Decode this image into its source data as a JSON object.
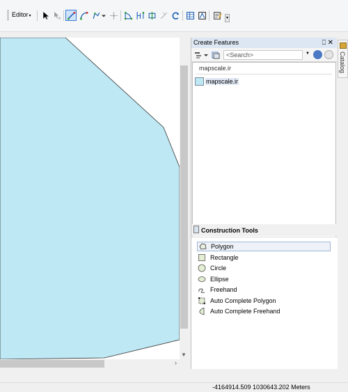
{
  "toolbar": {
    "editor_label": "Editor",
    "editor_caret": "▾",
    "tools": [
      "edit-tool-icon",
      "edit-annotation-icon",
      "straight-segment-icon",
      "endpoint-arc-icon",
      "trace-icon",
      "point-icon",
      "split-tool-icon",
      "vertices-icon",
      "reshape-icon",
      "cut-polygon-icon",
      "rotate-icon",
      "attributes-icon",
      "sketch-properties-icon",
      "create-features-icon"
    ],
    "overflow": "▾"
  },
  "map": {
    "polygon_fill": "#bee8f4",
    "polygon_stroke": "#333333"
  },
  "create_features": {
    "title": "Create Features",
    "pin": "⎕",
    "close": "✕",
    "search_placeholder": "<Search>",
    "group_label": "mapscale.ir",
    "template_label": "mapscale.ir"
  },
  "construction_tools": {
    "title": "Construction Tools",
    "items": [
      {
        "label": "Polygon",
        "icon": "polygon-icon",
        "selected": true
      },
      {
        "label": "Rectangle",
        "icon": "rectangle-icon",
        "selected": false
      },
      {
        "label": "Circle",
        "icon": "circle-icon",
        "selected": false
      },
      {
        "label": "Ellipse",
        "icon": "ellipse-icon",
        "selected": false
      },
      {
        "label": "Freehand",
        "icon": "freehand-icon",
        "selected": false
      },
      {
        "label": "Auto Complete Polygon",
        "icon": "auto-complete-polygon-icon",
        "selected": false
      },
      {
        "label": "Auto Complete Freehand",
        "icon": "auto-complete-freehand-icon",
        "selected": false
      }
    ]
  },
  "catalog_tab": {
    "label": "Catalog"
  },
  "status": {
    "coordinates": "-4164914.509  1030643.202 Meters"
  }
}
